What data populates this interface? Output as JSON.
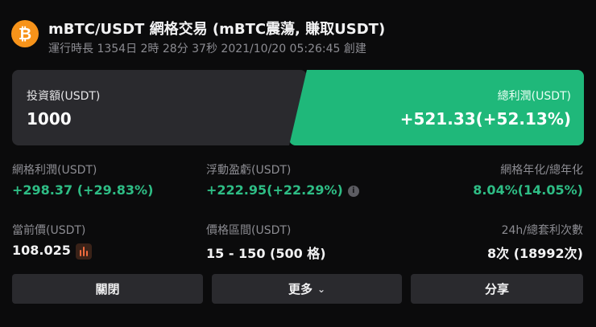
{
  "header": {
    "coin_icon": "bitcoin-icon",
    "coin_symbol": "₿",
    "title": "mBTC/USDT 網格交易 (mBTC震蕩, 賺取USDT)",
    "subtitle": "運行時長 1354日 2時 28分 37秒 2021/10/20 05:26:45 創建"
  },
  "cards": {
    "investment_label": "投資額(USDT)",
    "investment_value": "1000",
    "total_profit_label": "總利潤(USDT)",
    "total_profit_value": "+521.33(+52.13%)"
  },
  "stats": {
    "grid_profit_label": "網格利潤(USDT)",
    "grid_profit_value": "+298.37 (+29.83%)",
    "floating_pnl_label": "浮動盈虧(USDT)",
    "floating_pnl_value": "+222.95(+22.29%)",
    "annualized_label": "網格年化/總年化",
    "annualized_value": "8.04%(14.05%)",
    "current_price_label": "當前價(USDT)",
    "current_price_value": "108.025",
    "price_range_label": "價格區間(USDT)",
    "price_range_value": "15 - 150 (500 格)",
    "arbitrage_label": "24h/總套利次數",
    "arbitrage_value": "8次 (18992次)"
  },
  "buttons": {
    "close_label": "關閉",
    "more_label": "更多",
    "share_label": "分享"
  },
  "colors": {
    "accent_green": "#1fb87a",
    "profit_green": "#2ebd85",
    "bitcoin_orange": "#f7931a"
  }
}
